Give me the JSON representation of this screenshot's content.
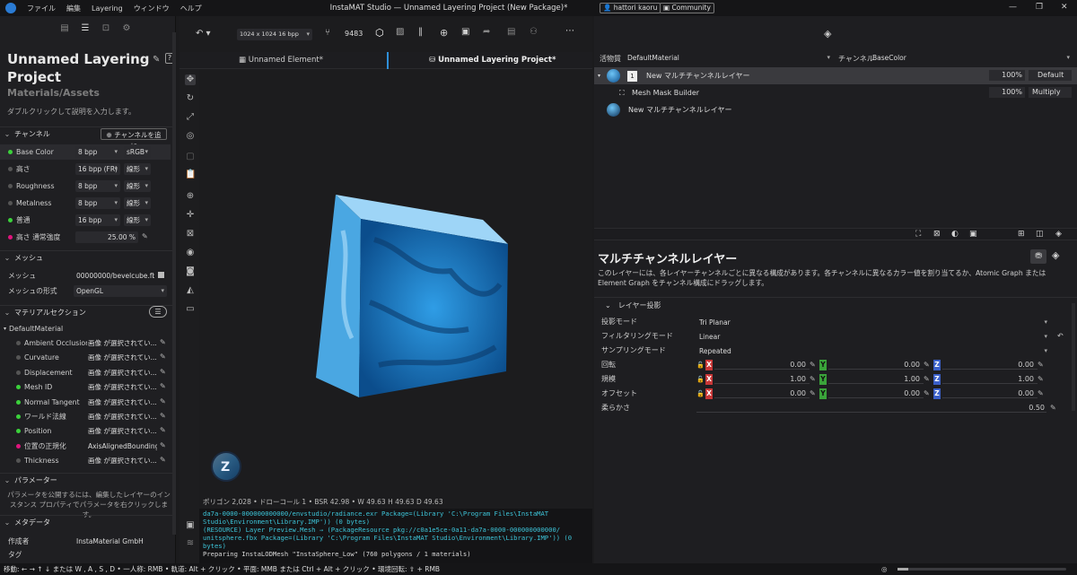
{
  "menu": [
    "ファイル",
    "編集",
    "Layering",
    "ウィンドウ",
    "ヘルプ"
  ],
  "window_title": "InstaMAT Studio — Unnamed Layering Project (New Package)*",
  "user": "hattori kaoru",
  "community": "Community",
  "project": {
    "title": "Unnamed Layering Project",
    "subtitle": "Materials/Assets",
    "description": "ダブルクリックして説明を入力します。"
  },
  "channels": {
    "header": "チャンネル",
    "add_button": "チャンネルを追加",
    "rows": [
      {
        "name": "Base Color",
        "bpp": "8 bpp",
        "mode": "sRGB",
        "color": "#3bd13b"
      },
      {
        "name": "高さ",
        "bpp": "16 bpp (FR)",
        "mode": "線形",
        "color": "#555555"
      },
      {
        "name": "Roughness",
        "bpp": "8 bpp",
        "mode": "線形",
        "color": "#555555"
      },
      {
        "name": "Metalness",
        "bpp": "8 bpp",
        "mode": "線形",
        "color": "#555555"
      },
      {
        "name": "普通",
        "bpp": "16 bpp",
        "mode": "線形",
        "color": "#3bd13b"
      }
    ],
    "height_strength": {
      "label": "高さ 通常強度",
      "value": "25.00 %",
      "color": "#e0147c"
    }
  },
  "mesh": {
    "header": "メッシュ",
    "mesh_label": "メッシュ",
    "mesh_value": "00000000/bevelcube.fbx",
    "format_label": "メッシュの形式",
    "format_value": "OpenGL"
  },
  "material_section": {
    "header": "マテリアルセクション",
    "default": "DefaultMaterial",
    "rows": [
      {
        "name": "Ambient Occlusion",
        "value": "画像 が選択されてい...",
        "color": "#555555"
      },
      {
        "name": "Curvature",
        "value": "画像 が選択されてい...",
        "color": "#555555"
      },
      {
        "name": "Displacement",
        "value": "画像 が選択されてい...",
        "color": "#555555"
      },
      {
        "name": "Mesh ID",
        "value": "画像 が選択されてい...",
        "color": "#3bd13b"
      },
      {
        "name": "Normal Tangent",
        "value": "画像 が選択されてい...",
        "color": "#3bd13b"
      },
      {
        "name": "ワールド法線",
        "value": "画像 が選択されてい...",
        "color": "#3bd13b"
      },
      {
        "name": "Position",
        "value": "画像 が選択されてい...",
        "color": "#3bd13b"
      },
      {
        "name": "位置の正規化",
        "value": "AxisAlignedBoundingBo",
        "color": "#e0147c"
      },
      {
        "name": "Thickness",
        "value": "画像 が選択されてい...",
        "color": "#555555"
      }
    ]
  },
  "parameters": {
    "header": "パラメーター",
    "text": "パラメータを公開するには、編集したレイヤーのインスタンス プロパティでパラメータを右クリックします。"
  },
  "metadata": {
    "header": "メタデータ",
    "author_label": "作成者",
    "author_value": "InstaMaterial GmbH",
    "tag_label": "タグ"
  },
  "viewport": {
    "resolution": "1024 x 1024 16 bpp",
    "count": "9483",
    "tab1": "Unnamed Element*",
    "tab2": "Unnamed Layering Project*",
    "status": "ポリゴン 2,028 • ドローコール 1 • BSR 42.98 • W 49.63 H 49.63 D 49.63"
  },
  "console": [
    "da7a-0000-000000000000/envstudio/radiance.exr Package=(Library 'C:\\Program Files\\InstaMAT",
    "Studio\\Environment\\Library.IMP')) (0 bytes)",
    "(RESOURCE) Layer Preview.Mesh → (PackageResource pkg://c0a1e5ce-0a11-da7a-0000-000000000000/",
    "unitsphere.fbx Package=(Library 'C:\\Program Files\\InstaMAT Studio\\Environment\\Library.IMP')) (0",
    "bytes)",
    "Preparing InstaLODMesh \"InstaSphere_Low\" (760 polygons / 1 materials)"
  ],
  "bottom_hint": "移動: ← → ↑ ↓ または W , A , S , D • 一人称: RMB • 軌道: Alt + クリック • 平面: MMB または Ctrl + Alt + クリック • 環境回転: ⇧ + RMB",
  "layers_panel": {
    "material_label": "活物質",
    "material_value": "DefaultMaterial",
    "channel_label": "チャンネル",
    "channel_value": "BaseColor",
    "rows": [
      {
        "name": "New マルチチャンネルレイヤー",
        "opacity": "100%",
        "blend": "Default",
        "badge": "1"
      },
      {
        "name": "Mesh Mask Builder",
        "opacity": "100%",
        "blend": "Multiply"
      },
      {
        "name": "New マルチチャンネルレイヤー"
      }
    ]
  },
  "inspector": {
    "title": "マルチチャンネルレイヤー",
    "description": "このレイヤーには、各レイヤーチャンネルごとに異なる構成があります。各チャンネルに異なるカラー値を割り当てるか、Atomic Graph または Element Graph をチャンネル構成にドラッグします。",
    "section": "レイヤー投影",
    "projection_label": "投影モード",
    "projection_value": "Tri Planar",
    "filter_label": "フィルタリングモード",
    "filter_value": "Linear",
    "sampling_label": "サンプリングモード",
    "sampling_value": "Repeated",
    "rotation_label": "回転",
    "rotation": [
      "0.00",
      "0.00",
      "0.00"
    ],
    "scale_label": "規模",
    "scale": [
      "1.00",
      "1.00",
      "1.00"
    ],
    "offset_label": "オフセット",
    "offset": [
      "0.00",
      "0.00",
      "0.00"
    ],
    "softness_label": "柔らかさ",
    "softness": "0.50",
    "axis": [
      "X",
      "Y",
      "Z"
    ]
  }
}
